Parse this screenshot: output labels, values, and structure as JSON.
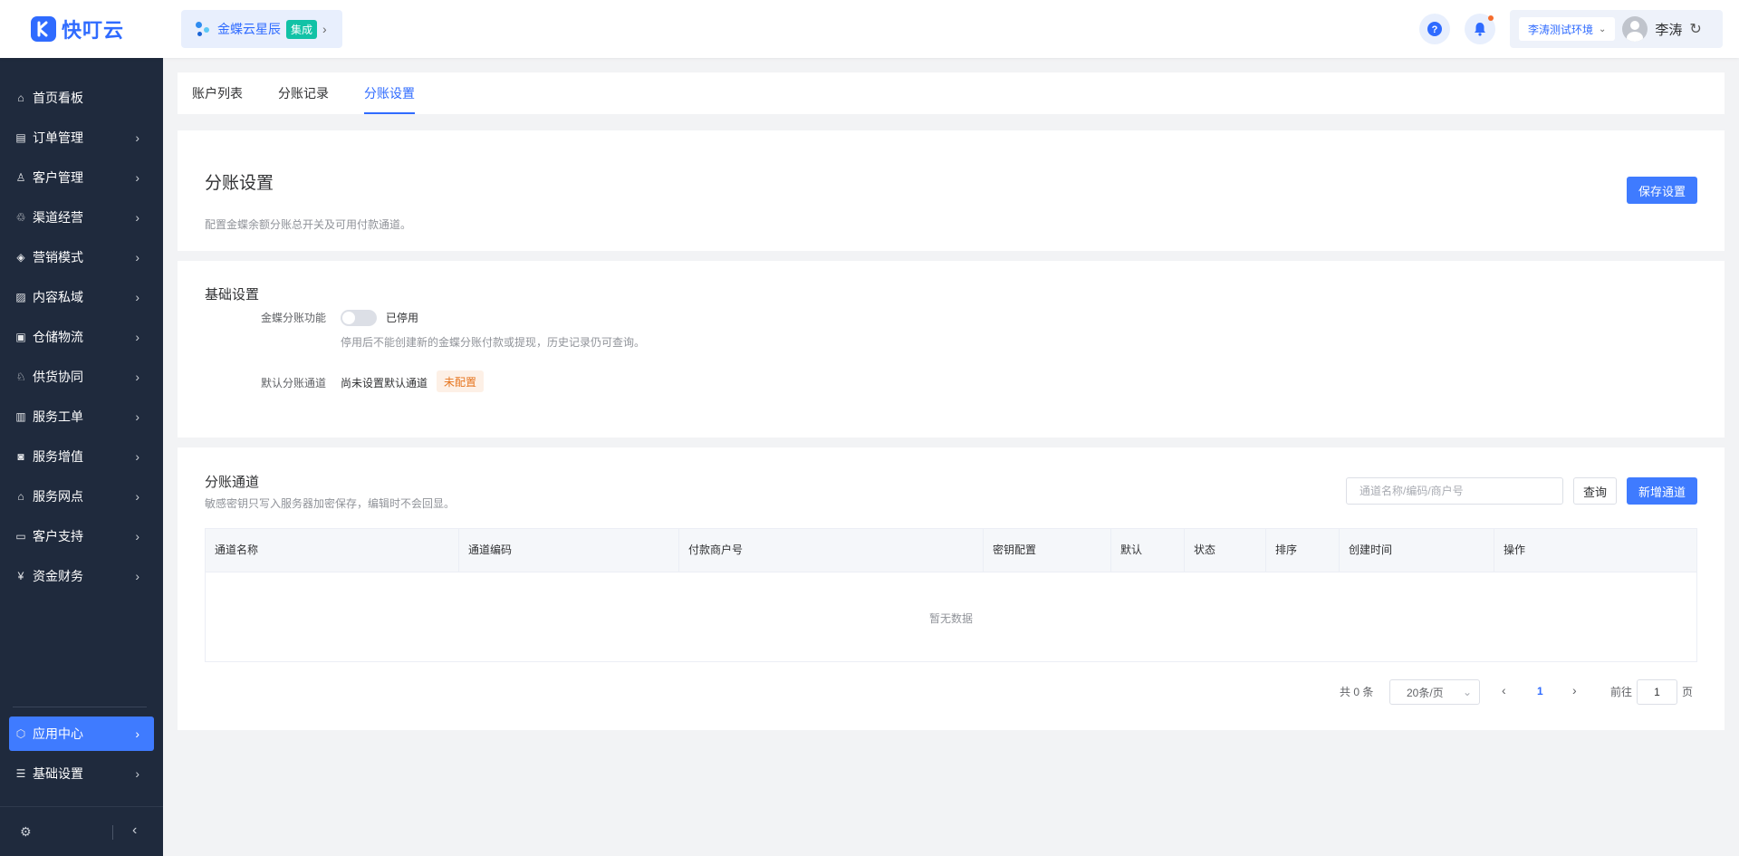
{
  "header": {
    "brand": "快叮云",
    "app_name": "金蝶云星辰",
    "app_tag": "集成",
    "env": "李涛测试环境",
    "user_name": "李涛"
  },
  "sidebar": {
    "items": [
      {
        "label": "首页看板",
        "icon": "home-icon"
      },
      {
        "label": "订单管理",
        "icon": "order-icon"
      },
      {
        "label": "客户管理",
        "icon": "user-icon"
      },
      {
        "label": "渠道经营",
        "icon": "channel-icon"
      },
      {
        "label": "营销模式",
        "icon": "tag-icon"
      },
      {
        "label": "内容私域",
        "icon": "image-icon"
      },
      {
        "label": "仓储物流",
        "icon": "box-icon"
      },
      {
        "label": "供货协同",
        "icon": "supply-icon"
      },
      {
        "label": "服务工单",
        "icon": "ticket-icon"
      },
      {
        "label": "服务增值",
        "icon": "bag-icon"
      },
      {
        "label": "服务网点",
        "icon": "store-icon"
      },
      {
        "label": "客户支持",
        "icon": "support-icon"
      },
      {
        "label": "资金财务",
        "icon": "yuan-icon"
      }
    ],
    "bottom_items": [
      {
        "label": "应用中心",
        "icon": "cube-icon",
        "active": true
      },
      {
        "label": "基础设置",
        "icon": "settings-list-icon"
      }
    ]
  },
  "tabs": [
    {
      "label": "账户列表",
      "active": false
    },
    {
      "label": "分账记录",
      "active": false
    },
    {
      "label": "分账设置",
      "active": true
    }
  ],
  "page": {
    "title": "分账设置",
    "description": "配置金蝶余额分账总开关及可用付款通道。",
    "save_label": "保存设置"
  },
  "basic": {
    "title": "基础设置",
    "feature_label": "金蝶分账功能",
    "feature_status": "已停用",
    "feature_hint": "停用后不能创建新的金蝶分账付款或提现，历史记录仍可查询。",
    "default_label": "默认分账通道",
    "default_value": "尚未设置默认通道",
    "default_tag": "未配置"
  },
  "channels": {
    "title": "分账通道",
    "description": "敏感密钥只写入服务器加密保存，编辑时不会回显。",
    "search_placeholder": "通道名称/编码/商户号",
    "query_label": "查询",
    "add_label": "新增通道",
    "columns": [
      "通道名称",
      "通道编码",
      "付款商户号",
      "密钥配置",
      "默认",
      "状态",
      "排序",
      "创建时间",
      "操作"
    ],
    "empty_text": "暂无数据"
  },
  "pagination": {
    "total": "共 0 条",
    "page_size": "20条/页",
    "current_page": "1",
    "goto_label": "前往",
    "goto_value": "1",
    "page_suffix": "页"
  },
  "colors": {
    "primary": "#3f7bff",
    "sidebar_bg": "#1f2a3d",
    "tag_orange": "#e6751f",
    "tag_green": "#11c2a6"
  }
}
